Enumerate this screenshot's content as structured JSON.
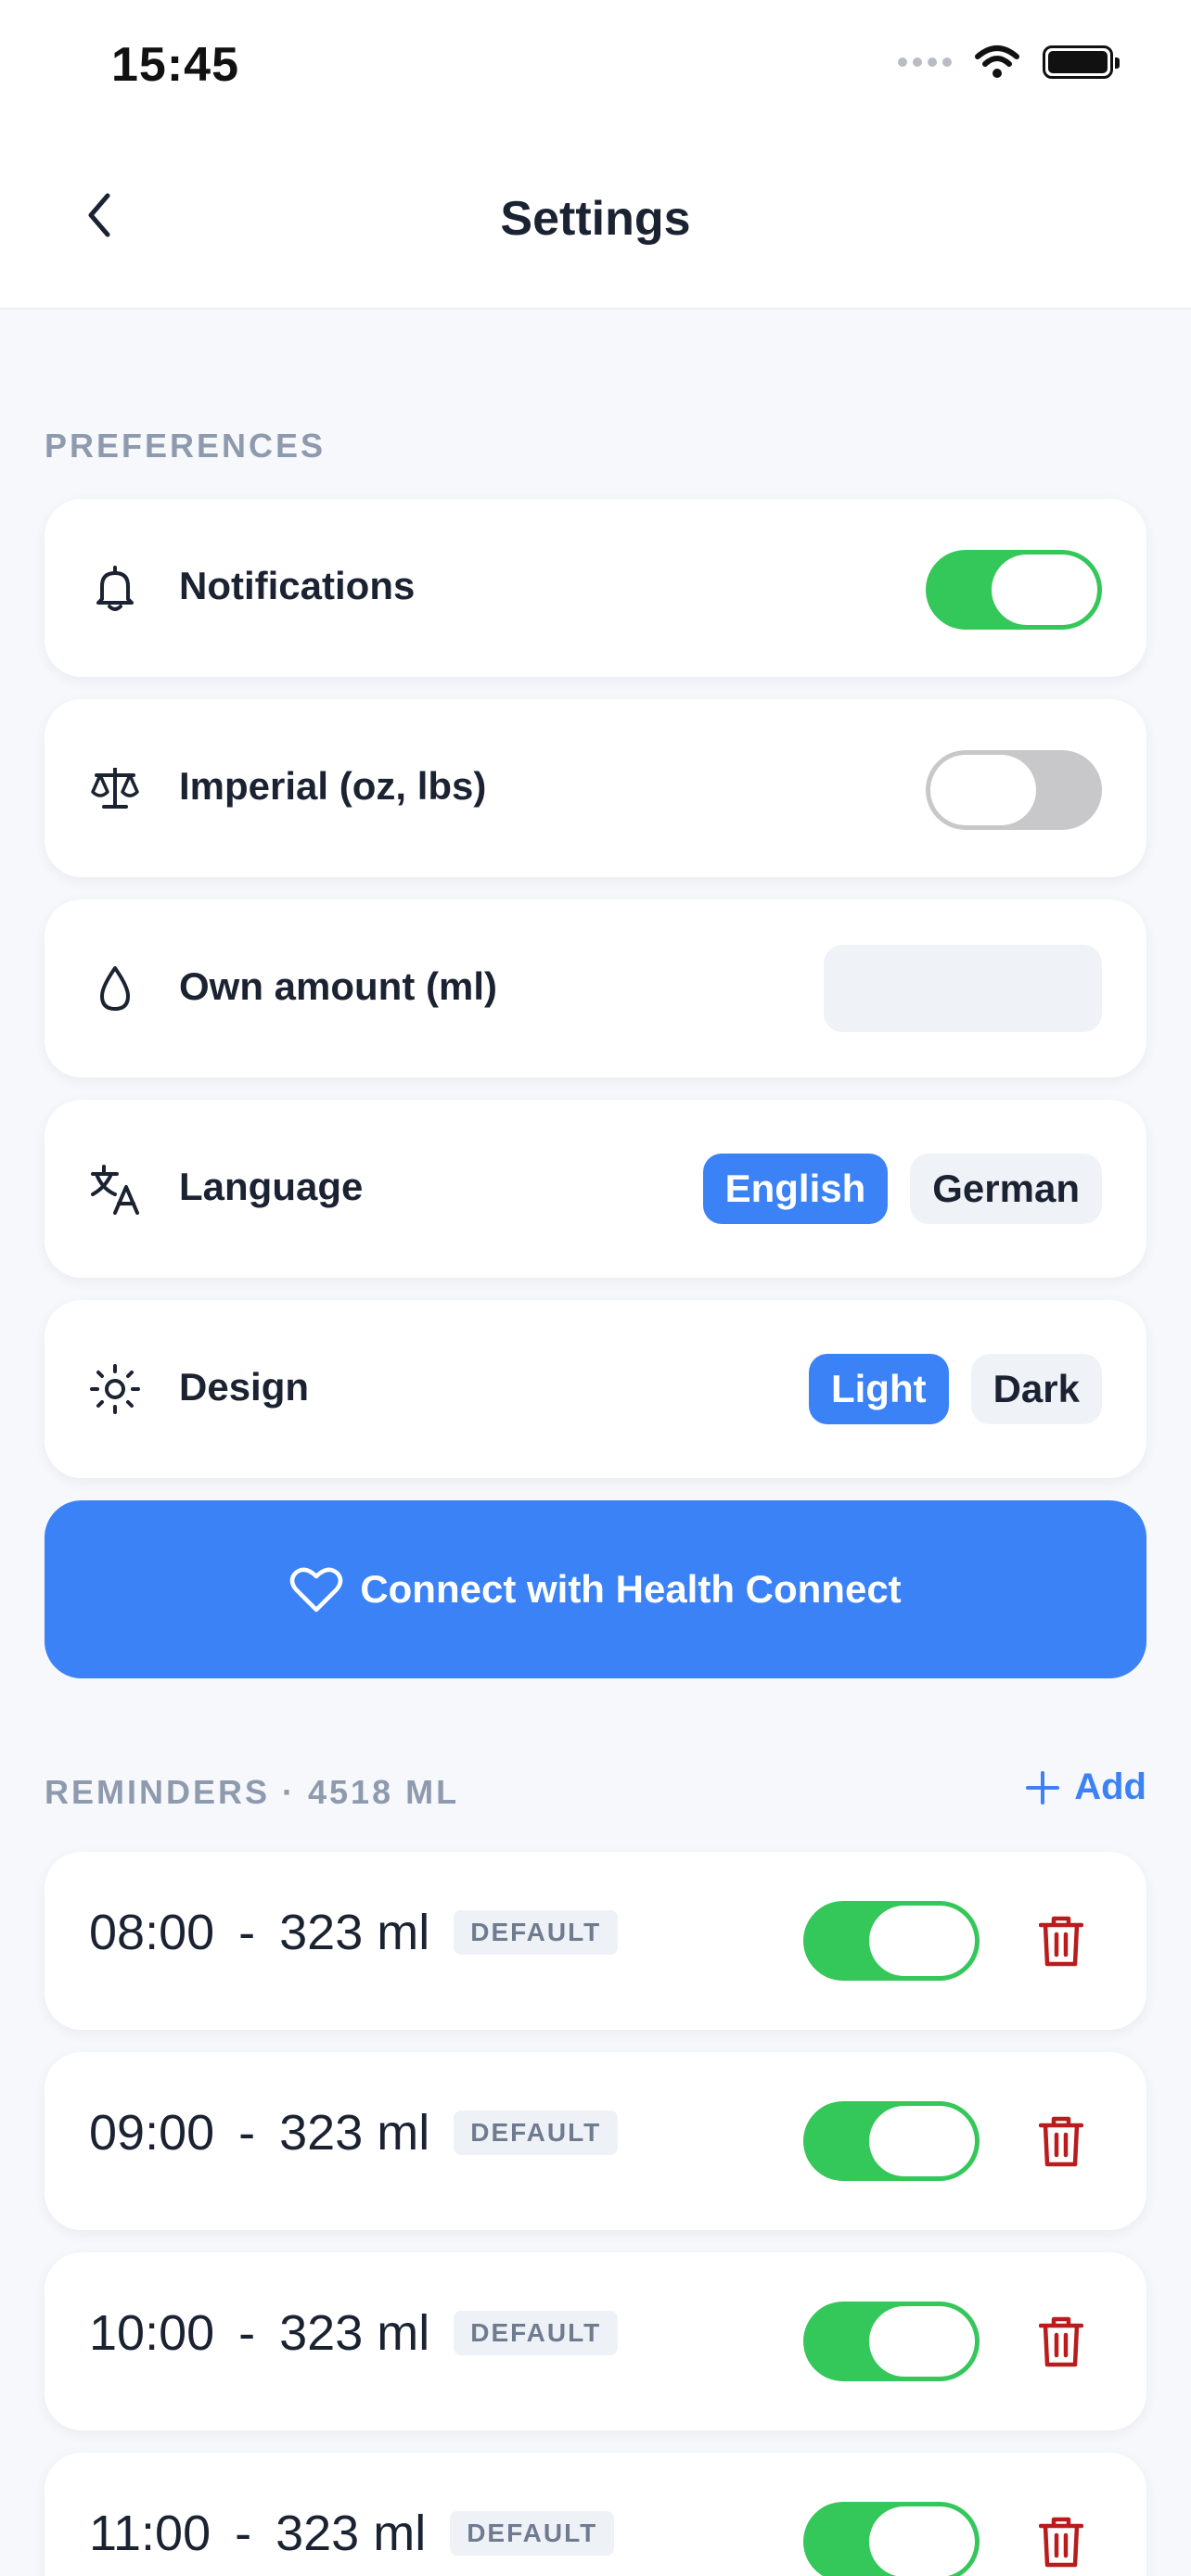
{
  "status_bar": {
    "time": "15:45"
  },
  "header": {
    "title": "Settings"
  },
  "sections": {
    "preferences": "PREFERENCES",
    "reminders": "REMINDERS · 4518 ML",
    "add_label": "Add"
  },
  "preferences": {
    "notifications": {
      "label": "Notifications",
      "icon": "bell-icon",
      "enabled": true
    },
    "imperial": {
      "label": "Imperial (oz, lbs)",
      "icon": "scale-icon",
      "enabled": false
    },
    "own_amount": {
      "label": "Own amount (ml)",
      "icon": "drop-icon",
      "value": ""
    },
    "language": {
      "label": "Language",
      "icon": "translate-icon",
      "options": [
        "English",
        "German"
      ],
      "selected": "English"
    },
    "design": {
      "label": "Design",
      "icon": "sun-icon",
      "options": [
        "Light",
        "Dark"
      ],
      "selected": "Light"
    }
  },
  "health_connect": {
    "label": "Connect with Health Connect",
    "icon": "heart-icon"
  },
  "reminders": [
    {
      "time": "08:00",
      "separator": "-",
      "amount": "323 ml",
      "badge": "DEFAULT",
      "enabled": true
    },
    {
      "time": "09:00",
      "separator": "-",
      "amount": "323 ml",
      "badge": "DEFAULT",
      "enabled": true
    },
    {
      "time": "10:00",
      "separator": "-",
      "amount": "323 ml",
      "badge": "DEFAULT",
      "enabled": true
    },
    {
      "time": "11:00",
      "separator": "-",
      "amount": "323 ml",
      "badge": "DEFAULT",
      "enabled": true
    }
  ],
  "colors": {
    "accent": "#3b82f6",
    "toggle_on": "#34c759",
    "toggle_off": "#c8c8cb",
    "delete": "#b91c1c",
    "background": "#f6f8fb"
  }
}
